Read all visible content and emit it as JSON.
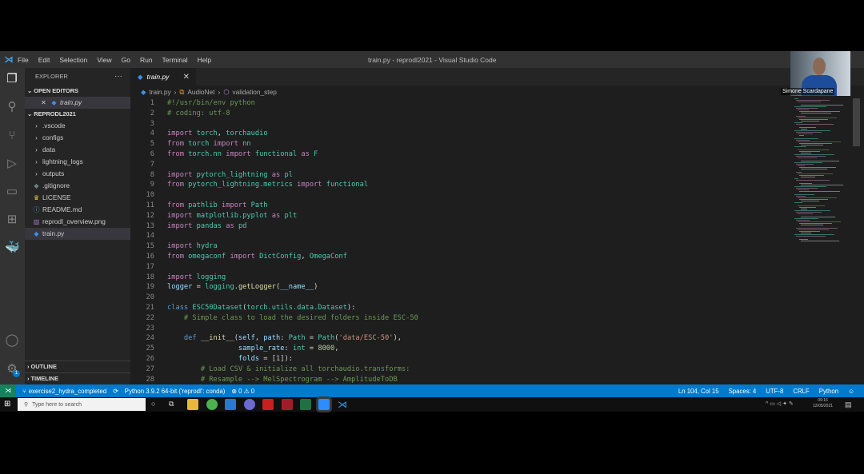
{
  "menu": {
    "items": [
      "File",
      "Edit",
      "Selection",
      "View",
      "Go",
      "Run",
      "Terminal",
      "Help"
    ],
    "title": "train.py - reprodl2021 - Visual Studio Code"
  },
  "sidebar": {
    "header": "EXPLORER",
    "open_editors": "OPEN EDITORS",
    "open_file": "train.py",
    "project": "REPRODL2021",
    "items": [
      {
        "label": ".vscode",
        "type": "folder"
      },
      {
        "label": "configs",
        "type": "folder"
      },
      {
        "label": "data",
        "type": "folder"
      },
      {
        "label": "lightning_logs",
        "type": "folder"
      },
      {
        "label": "outputs",
        "type": "folder"
      },
      {
        "label": ".gitignore",
        "type": "file"
      },
      {
        "label": "LICENSE",
        "type": "license"
      },
      {
        "label": "README.md",
        "type": "info"
      },
      {
        "label": "reprodl_overview.png",
        "type": "image"
      },
      {
        "label": "train.py",
        "type": "python",
        "selected": true
      }
    ],
    "outline": "OUTLINE",
    "timeline": "TIMELINE",
    "settings_badge": "1"
  },
  "tab": {
    "label": "train.py"
  },
  "breadcrumb": [
    "train.py",
    "AudioNet",
    "validation_step"
  ],
  "code": [
    [
      [
        "cm",
        "#!/usr/bin/env python"
      ]
    ],
    [
      [
        "cm",
        "# coding: utf-8"
      ]
    ],
    [],
    [
      [
        "kw",
        "import "
      ],
      [
        "mod",
        "torch"
      ],
      [
        "df",
        ", "
      ],
      [
        "mod",
        "torchaudio"
      ]
    ],
    [
      [
        "kw",
        "from "
      ],
      [
        "mod",
        "torch "
      ],
      [
        "kw",
        "import "
      ],
      [
        "mod",
        "nn"
      ]
    ],
    [
      [
        "kw",
        "from "
      ],
      [
        "mod",
        "torch.nn "
      ],
      [
        "kw",
        "import "
      ],
      [
        "mod",
        "functional "
      ],
      [
        "kw",
        "as "
      ],
      [
        "mod",
        "F"
      ]
    ],
    [],
    [
      [
        "kw",
        "import "
      ],
      [
        "mod",
        "pytorch_lightning "
      ],
      [
        "kw",
        "as "
      ],
      [
        "mod",
        "pl"
      ]
    ],
    [
      [
        "kw",
        "from "
      ],
      [
        "mod",
        "pytorch_lightning.metrics "
      ],
      [
        "kw",
        "import "
      ],
      [
        "mod",
        "functional"
      ]
    ],
    [],
    [
      [
        "kw",
        "from "
      ],
      [
        "mod",
        "pathlib "
      ],
      [
        "kw",
        "import "
      ],
      [
        "mod",
        "Path"
      ]
    ],
    [
      [
        "kw",
        "import "
      ],
      [
        "mod",
        "matplotlib.pyplot "
      ],
      [
        "kw",
        "as "
      ],
      [
        "mod",
        "plt"
      ]
    ],
    [
      [
        "kw",
        "import "
      ],
      [
        "mod",
        "pandas "
      ],
      [
        "kw",
        "as "
      ],
      [
        "mod",
        "pd"
      ]
    ],
    [],
    [
      [
        "kw",
        "import "
      ],
      [
        "mod",
        "hydra"
      ]
    ],
    [
      [
        "kw",
        "from "
      ],
      [
        "mod",
        "omegaconf "
      ],
      [
        "kw",
        "import "
      ],
      [
        "mod",
        "DictConfig"
      ],
      [
        "df",
        ", "
      ],
      [
        "mod",
        "OmegaConf"
      ]
    ],
    [],
    [
      [
        "kw",
        "import "
      ],
      [
        "mod",
        "logging"
      ]
    ],
    [
      [
        "vr",
        "logger"
      ],
      [
        "df",
        " = "
      ],
      [
        "mod",
        "logging"
      ],
      [
        "df",
        "."
      ],
      [
        "fn",
        "getLogger"
      ],
      [
        "df",
        "("
      ],
      [
        "vr",
        "__name__"
      ],
      [
        "df",
        ")"
      ]
    ],
    [],
    [
      [
        "bl",
        "class "
      ],
      [
        "mod",
        "ESC50Dataset"
      ],
      [
        "df",
        "("
      ],
      [
        "mod",
        "torch.utils.data.Dataset"
      ],
      [
        "df",
        "):"
      ]
    ],
    [
      [
        "df",
        "    "
      ],
      [
        "cm",
        "# Simple class to load the desired folders inside ESC-50"
      ]
    ],
    [],
    [
      [
        "df",
        "    "
      ],
      [
        "bl",
        "def "
      ],
      [
        "fn",
        "__init__"
      ],
      [
        "df",
        "("
      ],
      [
        "vr",
        "self"
      ],
      [
        "df",
        ", "
      ],
      [
        "vr",
        "path"
      ],
      [
        "df",
        ": "
      ],
      [
        "mod",
        "Path"
      ],
      [
        "df",
        " = "
      ],
      [
        "mod",
        "Path"
      ],
      [
        "df",
        "("
      ],
      [
        "st",
        "'data/ESC-50'"
      ],
      [
        "df",
        "),"
      ]
    ],
    [
      [
        "df",
        "                 "
      ],
      [
        "vr",
        "sample_rate"
      ],
      [
        "df",
        ": "
      ],
      [
        "mod",
        "int"
      ],
      [
        "df",
        " = "
      ],
      [
        "nu",
        "8000"
      ],
      [
        "df",
        ","
      ]
    ],
    [
      [
        "df",
        "                 "
      ],
      [
        "vr",
        "folds"
      ],
      [
        "df",
        " = ["
      ],
      [
        "nu",
        "1"
      ],
      [
        "df",
        "]):"
      ]
    ],
    [
      [
        "df",
        "        "
      ],
      [
        "cm",
        "# Load CSV & initialize all torchaudio.transforms:"
      ]
    ],
    [
      [
        "df",
        "        "
      ],
      [
        "cm",
        "# Resample --> MelSpectrogram --> AmplitudeToDB"
      ]
    ]
  ],
  "webcam": {
    "name": "Simone Scardapane"
  },
  "status": {
    "branch": "exercise2_hydra_completed",
    "interpreter": "Python 3.9.2 64-bit ('reprodl': conda)",
    "errors": "0",
    "warnings": "0",
    "position": "Ln 104, Col 15",
    "spaces": "Spaces: 4",
    "encoding": "UTF-8",
    "eol": "CRLF",
    "language": "Python"
  },
  "taskbar": {
    "search_placeholder": "Type here to search",
    "time": "09:16",
    "date": "12/05/2021"
  },
  "colors": {
    "accent": "#007acc",
    "remote": "#16825d"
  }
}
